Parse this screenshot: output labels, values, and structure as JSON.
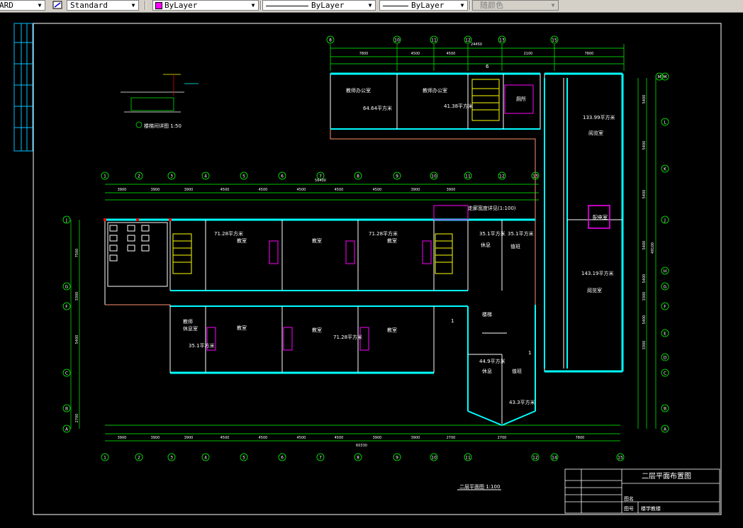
{
  "toolbar": {
    "text_style_left": "ARD",
    "text_style": "Standard",
    "layer": "ByLayer",
    "linetype": "ByLayer",
    "lineweight": "ByLayer",
    "plot_style": "随颜色",
    "colors": {
      "layer_swatch": "#ff00ff"
    }
  },
  "drawing": {
    "sheet_title": "二层平面布置图",
    "scale_caption": "二层平面图 1:100",
    "detail_caption": "楼梯间详图 1:50",
    "title_block": {
      "label_1": "图号",
      "label_2": "图名",
      "value_1": "",
      "value_2": "楼学教楼"
    },
    "rooms": {
      "r1": "教师办公室",
      "r1_area": "64.64平方米",
      "r2": "教师办公室",
      "r2_area": "41.38平方米",
      "r3": "厕所",
      "r4": "教室",
      "r4_area": "71.28平方米",
      "r5": "教室",
      "r6": "教室",
      "r6_area": "71.28平方米",
      "r7": "35.1平方米",
      "r7_b": "35.1平方米",
      "r8": "休息",
      "r8_b": "值班",
      "r9": "配电室",
      "r10": "133.99平方米",
      "r10_b": "阅览室",
      "r11": "143.19平方米",
      "r11_b": "阅览室",
      "r12": "教室",
      "r13": "教室",
      "r13_area": "71.28平方米",
      "r14": "教室",
      "r15": "35.1平方米",
      "r15_b": "教师",
      "r15_c": "休息室",
      "r16": "44.9平方米",
      "r16_b": "休息",
      "r17": "43.3平方米",
      "r17_b": "值班",
      "r18": "楼梯",
      "stair_note": "走廊宽度详见(1:100)",
      "tag_top": "6",
      "tag_mid": "1",
      "tag_low": "1"
    },
    "axes": {
      "top_lower": [
        "1",
        "2",
        "3",
        "4",
        "5",
        "6",
        "7",
        "8",
        "9",
        "10",
        "11",
        "12",
        "13"
      ],
      "top_upper": [
        "8",
        "10",
        "11",
        "12",
        "13",
        "15"
      ],
      "bottom": [
        "1",
        "2",
        "3",
        "4",
        "5",
        "6",
        "7",
        "8",
        "9",
        "10",
        "11",
        "12",
        "14",
        "15"
      ],
      "right": [
        "M",
        "L",
        "K",
        "J",
        "H",
        "G",
        "F",
        "E",
        "D",
        "C",
        "B",
        "A"
      ],
      "left": [
        "J",
        "G",
        "F",
        "C",
        "B",
        "A"
      ]
    },
    "dims": {
      "top_upper_total": "24450",
      "top_upper": [
        "7800",
        "4500",
        "4500",
        "2100",
        "7800"
      ],
      "top_lower_total": "56400",
      "top_lower": [
        "3900",
        "3900",
        "3900",
        "4500",
        "4500",
        "4500",
        "4500",
        "4500",
        "3900",
        "3900"
      ],
      "bottom_total": "60330",
      "bottom": [
        "3900",
        "3900",
        "3900",
        "4500",
        "4500",
        "4500",
        "4500",
        "3900",
        "3900",
        "2700",
        "2700",
        "7800"
      ],
      "right": [
        "5400",
        "5400",
        "5400",
        "5400",
        "5400",
        "3300",
        "5400",
        "3300"
      ],
      "right_total": "49100",
      "left": [
        "7500",
        "3300",
        "5400",
        "2700"
      ]
    }
  }
}
